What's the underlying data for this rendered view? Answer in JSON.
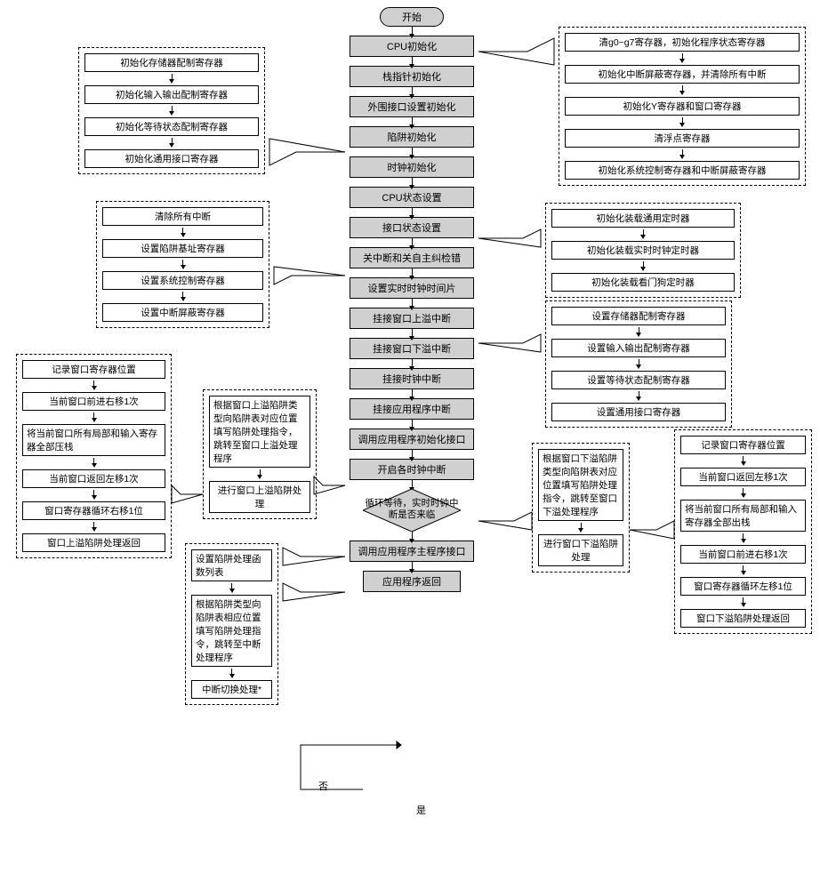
{
  "start": "开始",
  "main": {
    "n1": "CPU初始化",
    "n2": "栈指针初始化",
    "n3": "外围接口设置初始化",
    "n4": "陷阱初始化",
    "n5": "时钟初始化",
    "n6": "CPU状态设置",
    "n7": "接口状态设置",
    "n8": "关中断和关自主纠检错",
    "n9": "设置实时时钟时间片",
    "n10": "挂接窗口上溢中断",
    "n11": "挂接窗口下溢中断",
    "n12": "挂接时钟中断",
    "n13": "挂接应用程序中断",
    "n14": "调用应用程序初始化接口",
    "n15": "开启各时钟中断",
    "n16": "调用应用程序主程序接口",
    "n17": "应用程序返回"
  },
  "decision": "循环等待，实时时钟中断是否来临",
  "dec_no": "否",
  "dec_yes": "是",
  "group_periph": {
    "items": [
      "初始化存储器配制寄存器",
      "初始化输入输出配制寄存器",
      "初始化等待状态配制寄存器",
      "初始化通用接口寄存器"
    ]
  },
  "group_cpu_init": {
    "items": [
      "清g0~g7寄存器，初始化程序状态寄存器",
      "初始化中断屏蔽寄存器，并清除所有中断",
      "初始化Y寄存器和窗口寄存器",
      "清浮点寄存器",
      "初始化系统控制寄存器和中断屏蔽寄存器"
    ]
  },
  "group_cpu_state": {
    "items": [
      "清除所有中断",
      "设置陷阱基址寄存器",
      "设置系统控制寄存器",
      "设置中断屏蔽寄存器"
    ]
  },
  "group_clock": {
    "items": [
      "初始化装载通用定时器",
      "初始化装载实时时钟定时器",
      "初始化装载看门狗定时器"
    ]
  },
  "group_if_state": {
    "items": [
      "设置存储器配制寄存器",
      "设置输入输出配制寄存器",
      "设置等待状态配制寄存器",
      "设置通用接口寄存器"
    ]
  },
  "group_win_overflow_hook": {
    "items": [
      "根据窗口上溢陷阱类型向陷阱表对应位置填写陷阱处理指令，跳转至窗口上溢处理程序",
      "进行窗口上溢陷阱处理"
    ]
  },
  "group_win_overflow_detail": {
    "items": [
      "记录窗口寄存器位置",
      "当前窗口前进右移1次",
      "将当前窗口所有局部和输入寄存器全部压栈",
      "当前窗口返回左移1次",
      "窗口寄存器循环右移1位",
      "窗口上溢陷阱处理返回"
    ]
  },
  "group_win_underflow_hook": {
    "items": [
      "根据窗口下溢陷阱类型向陷阱表对应位置填写陷阱处理指令，跳转至窗口下溢处理程序",
      "进行窗口下溢陷阱处理"
    ]
  },
  "group_win_underflow_detail": {
    "items": [
      "记录窗口寄存器位置",
      "当前窗口返回左移1次",
      "将当前窗口所有局部和输入寄存器全部出栈",
      "当前窗口前进右移1次",
      "窗口寄存器循环左移1位",
      "窗口下溢陷阱处理返回"
    ]
  },
  "group_clock_int": {
    "items": [
      "设置陷阱处理函数列表",
      "根据陷阱类型向陷阱表相应位置填写陷阱处理指令，跳转至中断处理程序",
      "中断切换处理*"
    ]
  }
}
